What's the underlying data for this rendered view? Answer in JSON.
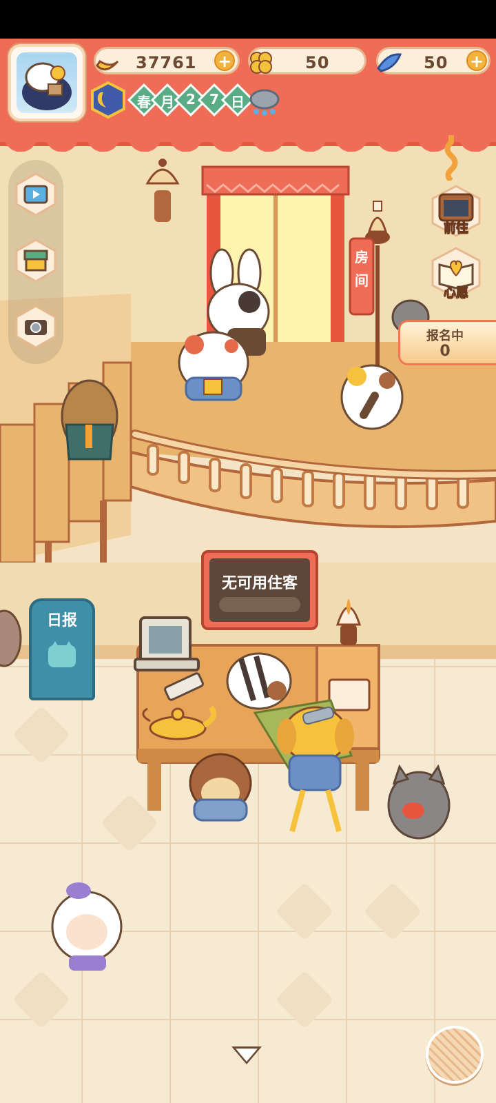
{
  "currencies": [
    {
      "name": "banana",
      "value": "37761",
      "plus": "+"
    },
    {
      "name": "clover",
      "value": "50"
    },
    {
      "name": "fish",
      "value": "50",
      "plus": "+"
    }
  ],
  "date": {
    "chars": [
      "春",
      "月",
      "2",
      "7",
      "日"
    ]
  },
  "weather": "rain-cloud-icon",
  "side_menu": [
    "tv-icon",
    "shop-icon",
    "camera-icon"
  ],
  "right_buttons": {
    "goto_label": "前往",
    "wish_label": "心愿"
  },
  "signup": {
    "title": "报名中",
    "count": "0"
  },
  "board": {
    "text": "无可用住客"
  },
  "room_sign": "房间",
  "daily_paper": "日报",
  "colors": {
    "banner": "#ef6c57",
    "accent_green": "#58ad84",
    "wood": "#e8b46e",
    "text_brown": "#6b4a33"
  }
}
